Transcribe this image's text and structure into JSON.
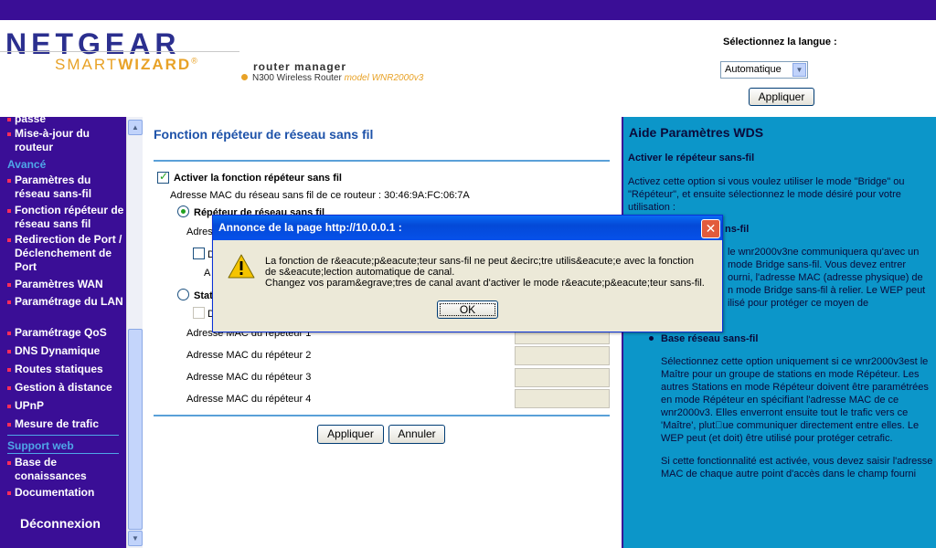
{
  "header": {
    "brand": "NETGEAR",
    "smart": "SMART",
    "wizard": "WIZARD",
    "registered": "®",
    "app_title": "router manager",
    "device": "N300 Wireless Router",
    "model": "model WNR2000v3",
    "lang_label": "Sélectionnez la langue :",
    "lang_value": "Automatique",
    "lang_apply": "Appliquer"
  },
  "sidebar": {
    "items_top": [
      {
        "label": "passe"
      },
      {
        "label": "Mise-à-jour du routeur"
      }
    ],
    "section_advanced": "Avancé",
    "items_advanced": [
      {
        "label": "Paramètres du réseau sans-fil"
      },
      {
        "label": "Fonction répéteur de réseau sans fil"
      },
      {
        "label": "Redirection de Port / Déclenchement de Port"
      },
      {
        "label": "Paramètres WAN"
      },
      {
        "label": "Paramétrage du LAN"
      },
      {
        "label": "Paramétrage QoS"
      },
      {
        "label": "DNS Dynamique"
      },
      {
        "label": "Routes statiques"
      },
      {
        "label": "Gestion à distance"
      },
      {
        "label": "UPnP"
      },
      {
        "label": "Mesure de trafic"
      }
    ],
    "section_support": "Support web",
    "items_support": [
      {
        "label": "Base de conaissances"
      },
      {
        "label": "Documentation"
      }
    ],
    "logout": "Déconnexion"
  },
  "main": {
    "title": "Fonction répéteur de réseau sans fil",
    "enable_label": "Activer la fonction répéteur sans fil",
    "mac_info": "Adresse MAC du réseau sans fil de ce routeur : 30:46:9A:FC:06:7A",
    "radio1_label": "Répéteur de réseau sans fil",
    "ip_label_partial": "Adres",
    "d_partial": "D",
    "a_partial": "A",
    "radio2_label": "Stat",
    "d2_partial": "D",
    "repeater_labels": [
      "Adresse MAC du répéteur 1",
      "Adresse MAC du répéteur 2",
      "Adresse MAC du répéteur 3",
      "Adresse MAC du répéteur 4"
    ],
    "apply": "Appliquer",
    "cancel": "Annuler"
  },
  "help": {
    "title": "Aide Paramètres WDS",
    "h1": "Activer le répéteur sans-fil",
    "p1": [
      "Activez cette option si vous voulez utiliser le mode \"Bridge\" ou",
      "\"Répéteur\", et ensuite sélectionnez le mode désiré pour votre",
      "utilisation :"
    ],
    "h2_partial": "ns-fil",
    "p2": [
      "le wnr2000v3ne communiquera qu'avec un",
      "mode Bridge sans-fil. Vous devez entrer",
      "ourni, l'adresse MAC (adresse physique) de",
      "n mode Bridge sans-fil à relier. Le WEP peut",
      "ilisé pour protéger ce moyen de"
    ],
    "h3": "Base réseau sans-fil",
    "p3": [
      "Sélectionnez cette option uniquement si ce wnr2000v3est le",
      "Maître pour un groupe de stations en mode Répéteur. Les",
      "autres Stations en mode Répéteur doivent être paramétrées",
      "en mode Répéteur en spécifiant l'adresse MAC de ce",
      "wnr2000v3. Elles enverront ensuite tout le trafic vers ce",
      "'Maître', plut\u0000ue communiquer directement entre elles. Le",
      "WEP peut (et doit) être utilisé pour protéger cetrafic."
    ],
    "p4": [
      "Si cette fonctionnalité est activée, vous devez saisir l'adresse",
      "MAC de chaque autre point d'accès dans le champ fourni"
    ]
  },
  "dialog": {
    "title": "Annonce de la page http://10.0.0.1 :",
    "lines": [
      "La fonction de r&eacute;p&eacute;teur sans-fil ne peut &ecirc;tre utilis&eacute;e avec la fonction",
      "de s&eacute;lection automatique de canal.",
      "Changez vos param&egrave;tres de canal avant d'activer le mode r&eacute;p&eacute;teur sans-fil."
    ],
    "ok": "OK",
    "close": "✕"
  }
}
